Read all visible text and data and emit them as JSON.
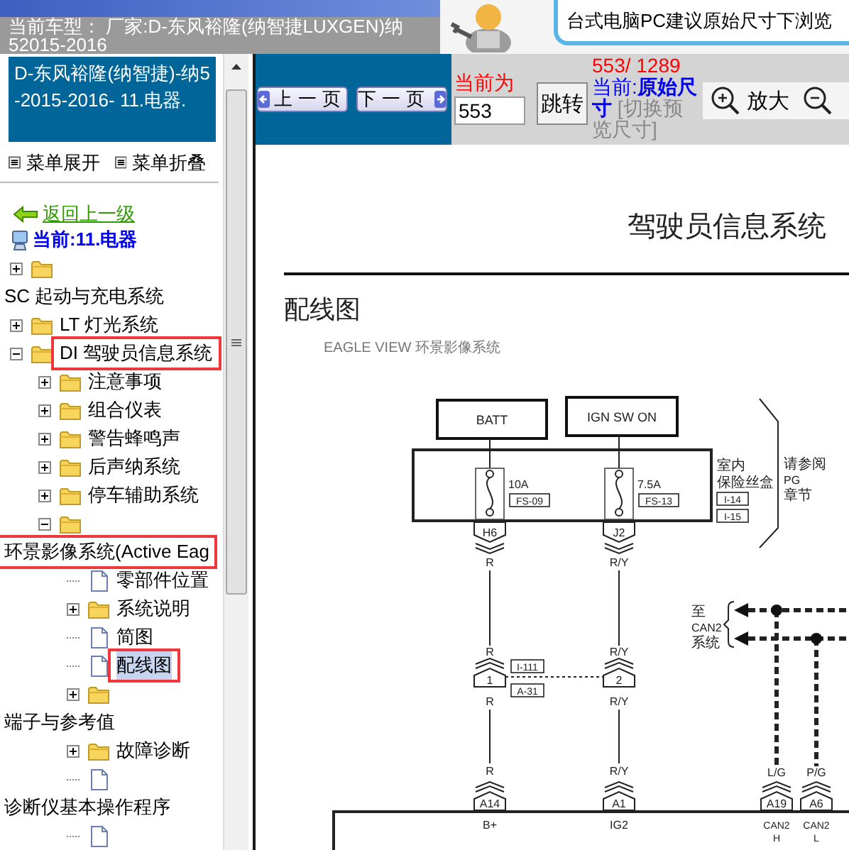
{
  "header": {
    "lines": [
      "当前车型： 厂家:D-东风裕隆(纳智捷LUXGEN)纳",
      "52015-2016"
    ]
  },
  "banner": {
    "text": "台式电脑PC建议原始尺寸下浏览"
  },
  "nav": {
    "title": "D-东风裕隆(纳智捷)-纳5-2015-2016- 11.电器.",
    "expand_all": "菜单展开",
    "collapse_all": "菜单折叠",
    "back": "返回上一级",
    "current": "当前:11.电器",
    "tree": [
      {
        "kind": "folder",
        "label": "SC 起动与充电系统",
        "expanded": false,
        "selected": false,
        "marked": false
      },
      {
        "kind": "folder",
        "label": "LT 灯光系统",
        "expanded": false,
        "selected": false,
        "marked": false
      },
      {
        "kind": "folder",
        "label": "DI 驾驶员信息系统",
        "expanded": true,
        "selected": false,
        "marked": true,
        "children": [
          {
            "kind": "folder",
            "label": "注意事项",
            "expanded": false,
            "selected": false,
            "marked": false
          },
          {
            "kind": "folder",
            "label": "组合仪表",
            "expanded": false,
            "selected": false,
            "marked": false
          },
          {
            "kind": "folder",
            "label": "警告蜂鸣声",
            "expanded": false,
            "selected": false,
            "marked": false
          },
          {
            "kind": "folder",
            "label": "后声纳系统",
            "expanded": false,
            "selected": false,
            "marked": false
          },
          {
            "kind": "folder",
            "label": "停车辅助系统",
            "expanded": false,
            "selected": false,
            "marked": false
          },
          {
            "kind": "folder",
            "label": "环景影像系统(Active Eag",
            "expanded": true,
            "selected": false,
            "marked": true,
            "children": [
              {
                "kind": "doc",
                "label": "零部件位置",
                "selected": false,
                "marked": false
              },
              {
                "kind": "folder",
                "label": "系统说明",
                "expanded": false,
                "selected": false,
                "marked": false
              },
              {
                "kind": "doc",
                "label": "简图",
                "selected": false,
                "marked": false
              },
              {
                "kind": "doc",
                "label": "配线图",
                "selected": true,
                "marked": true
              },
              {
                "kind": "folder",
                "label": "端子与参考值",
                "expanded": false,
                "selected": false,
                "marked": false
              },
              {
                "kind": "folder",
                "label": "故障诊断",
                "expanded": false,
                "selected": false,
                "marked": false
              },
              {
                "kind": "doc",
                "label": "诊断仪基本操作程序",
                "selected": false,
                "marked": false
              },
              {
                "kind": "doc",
                "selected": false,
                "marked": false
              }
            ]
          }
        ]
      }
    ]
  },
  "toolbar": {
    "prev": "上一页",
    "next": "下一页",
    "page_label": "当前为",
    "page_input": "553",
    "jump": "跳转",
    "page_count": "553/ 1289",
    "size_label": "当前:",
    "size_value": "原始尺寸",
    "size_switch": "[切换预览尺寸]",
    "zoom_in": "放大"
  },
  "doc": {
    "section_title": "驾驶员信息系统",
    "heading": "配线图",
    "caption": "EAGLE VIEW 环景影像系统",
    "diagram": {
      "circuits": [
        {
          "source": "BATT",
          "fuse_rating": "10A",
          "fuse_id": "FS-09",
          "fuse_pin": "H6",
          "wire_labels": [
            "R",
            "R",
            "R",
            "R"
          ],
          "joint_pin": "1",
          "module_pin": "A14",
          "module_label": "B+"
        },
        {
          "source": "IGN SW ON",
          "fuse_rating": "7.5A",
          "fuse_id": "FS-13",
          "fuse_pin": "J2",
          "wire_labels": [
            "R/Y",
            "R/Y",
            "R/Y",
            "R/Y"
          ],
          "joint_pin": "2",
          "module_pin": "A1",
          "module_label": "IG2"
        }
      ],
      "fuse_box": {
        "label_lines": [
          "室内",
          "保险丝盒"
        ],
        "connectors": [
          "I-14",
          "I-15"
        ]
      },
      "reference_lines": [
        "请参阅",
        "PG",
        "章节"
      ],
      "joint_connectors": [
        "I-111",
        "A-31"
      ],
      "can": {
        "label_lines": [
          "至",
          "CAN2",
          "系统"
        ],
        "lines": [
          {
            "wire": "L/G",
            "pin": "A19",
            "module_label_lines": [
              "CAN2",
              "H"
            ]
          },
          {
            "wire": "P/G",
            "pin": "A6",
            "module_label_lines": [
              "CAN2",
              "L"
            ]
          }
        ]
      }
    }
  }
}
